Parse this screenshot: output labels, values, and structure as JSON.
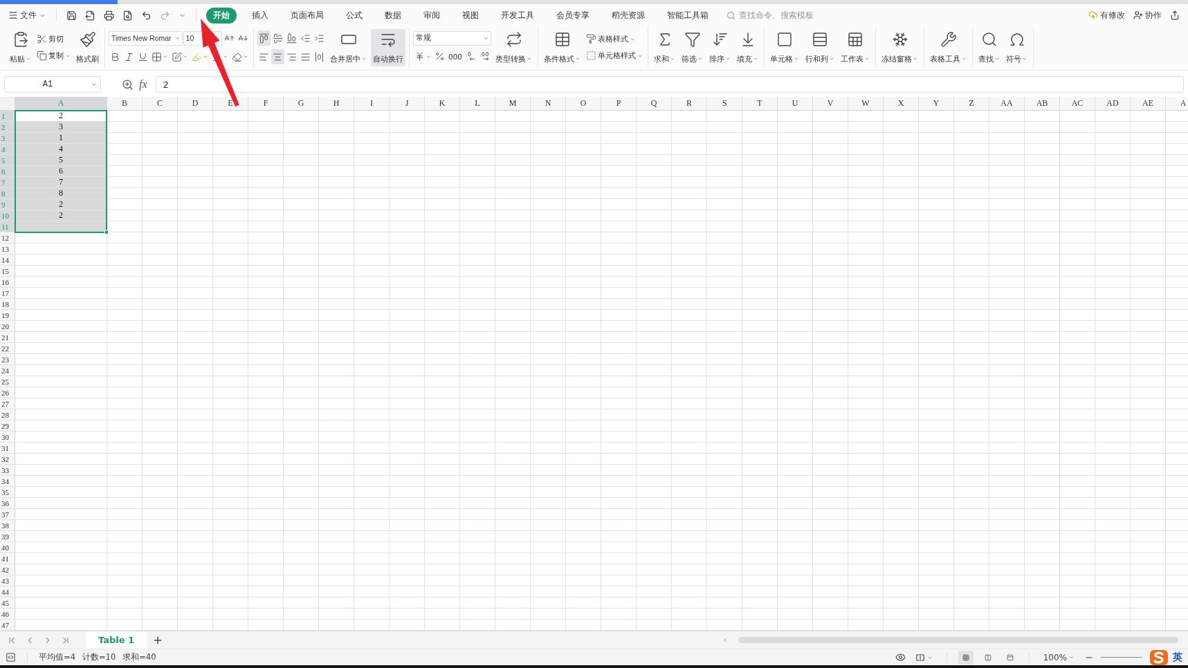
{
  "menu": {
    "file": "文件",
    "tabs": [
      {
        "label": "开始",
        "selected": true
      },
      {
        "label": "插入",
        "selected": false
      },
      {
        "label": "页面布局",
        "selected": false
      },
      {
        "label": "公式",
        "selected": false
      },
      {
        "label": "数据",
        "selected": false
      },
      {
        "label": "审阅",
        "selected": false
      },
      {
        "label": "视图",
        "selected": false
      },
      {
        "label": "开发工具",
        "selected": false
      },
      {
        "label": "会员专享",
        "selected": false
      },
      {
        "label": "稻壳资源",
        "selected": false
      },
      {
        "label": "智能工具箱",
        "selected": false
      }
    ],
    "search": {
      "placeholder": "查找命令、搜索模板"
    },
    "status": "有修改",
    "collaborate": "协作"
  },
  "ribbon": [
    {
      "columns": [
        {
          "kind": "big",
          "label": "粘贴",
          "dropdown": true
        },
        {
          "kind": "stack",
          "rows": [
            [
              {
                "kind": "small",
                "label": "剪切",
                "dropdown": false
              }
            ],
            [
              {
                "kind": "small",
                "label": "复制",
                "dropdown": true
              }
            ]
          ]
        },
        {
          "kind": "big",
          "label": "格式刷",
          "dropdown": false
        }
      ]
    },
    {
      "columns": [
        {
          "kind": "stack",
          "rows": [
            [
              {
                "kind": "select",
                "value": "Times New Romar"
              },
              {
                "kind": "select",
                "value": "10"
              },
              {
                "kind": "icon",
                "dropdown": false
              },
              {
                "kind": "icon",
                "dropdown": false
              }
            ],
            [
              {
                "kind": "icon",
                "dropdown": false
              },
              {
                "kind": "icon",
                "dropdown": false
              },
              {
                "kind": "icon",
                "dropdown": false
              },
              {
                "kind": "icon",
                "dropdown": true
              },
              {
                "kind": "icon",
                "dropdown": true
              },
              {
                "kind": "icon",
                "dropdown": true
              },
              {
                "kind": "icon",
                "dropdown": true
              },
              {
                "kind": "icon",
                "dropdown": true
              }
            ]
          ]
        }
      ]
    },
    {
      "columns": [
        {
          "kind": "stack",
          "rows": [
            [
              {
                "kind": "icon",
                "dropdown": false,
                "on": true
              },
              {
                "kind": "icon",
                "dropdown": false,
                "on": false
              },
              {
                "kind": "icon",
                "dropdown": false,
                "on": false
              },
              {
                "kind": "icon",
                "dropdown": false,
                "on": false
              },
              {
                "kind": "icon",
                "dropdown": false,
                "on": false
              }
            ],
            [
              {
                "kind": "icon",
                "dropdown": false,
                "on": false
              },
              {
                "kind": "icon",
                "dropdown": false,
                "on": true
              },
              {
                "kind": "icon",
                "dropdown": false,
                "on": false
              },
              {
                "kind": "icon",
                "dropdown": false,
                "on": false
              },
              {
                "kind": "icon",
                "dropdown": false,
                "on": false
              }
            ]
          ]
        },
        {
          "kind": "big",
          "label": "合并居中",
          "dropdown": true,
          "on": false
        },
        {
          "kind": "big",
          "label": "自动换行",
          "dropdown": false,
          "on": true
        }
      ]
    },
    {
      "columns": [
        {
          "kind": "stack",
          "rows": [
            [
              {
                "kind": "select",
                "value": "常规"
              }
            ],
            [
              {
                "kind": "icon",
                "dropdown": true
              },
              {
                "kind": "icon",
                "dropdown": false
              },
              {
                "kind": "text",
                "label": "000"
              },
              {
                "kind": "icon",
                "dropdown": false
              },
              {
                "kind": "icon",
                "dropdown": false
              }
            ]
          ]
        },
        {
          "kind": "big",
          "label": "类型转换",
          "dropdown": true
        }
      ]
    },
    {
      "columns": [
        {
          "kind": "big",
          "label": "条件格式",
          "dropdown": true
        },
        {
          "kind": "stack",
          "rows": [
            [
              {
                "kind": "small",
                "label": "表格样式",
                "dropdown": true
              }
            ],
            [
              {
                "kind": "small",
                "label": "单元格样式",
                "dropdown": true
              }
            ]
          ]
        }
      ]
    },
    {
      "columns": [
        {
          "kind": "big",
          "label": "求和",
          "dropdown": true
        },
        {
          "kind": "big",
          "label": "筛选",
          "dropdown": true
        },
        {
          "kind": "big",
          "label": "排序",
          "dropdown": true
        },
        {
          "kind": "big",
          "label": "填充",
          "dropdown": true
        }
      ]
    },
    {
      "columns": [
        {
          "kind": "big",
          "label": "单元格",
          "dropdown": true
        },
        {
          "kind": "big",
          "label": "行和列",
          "dropdown": true
        },
        {
          "kind": "big",
          "label": "工作表",
          "dropdown": true
        }
      ]
    },
    {
      "columns": [
        {
          "kind": "big",
          "label": "冻结窗格",
          "dropdown": true
        }
      ]
    },
    {
      "columns": [
        {
          "kind": "big",
          "label": "表格工具",
          "dropdown": true
        }
      ]
    },
    {
      "columns": [
        {
          "kind": "big",
          "label": "查找",
          "dropdown": true
        },
        {
          "kind": "big",
          "label": "符号",
          "dropdown": true
        }
      ]
    }
  ],
  "formula_bar": {
    "cell": "A1",
    "fx": "fx",
    "formula": "2"
  },
  "columns": [
    {
      "label": "A",
      "selected": true
    },
    {
      "label": "B",
      "selected": false
    },
    {
      "label": "C",
      "selected": false
    },
    {
      "label": "D",
      "selected": false
    },
    {
      "label": "E",
      "selected": false
    },
    {
      "label": "F",
      "selected": false
    },
    {
      "label": "G",
      "selected": false
    },
    {
      "label": "H",
      "selected": false
    },
    {
      "label": "I",
      "selected": false
    },
    {
      "label": "J",
      "selected": false
    },
    {
      "label": "K",
      "selected": false
    },
    {
      "label": "L",
      "selected": false
    },
    {
      "label": "M",
      "selected": false
    },
    {
      "label": "N",
      "selected": false
    },
    {
      "label": "O",
      "selected": false
    },
    {
      "label": "P",
      "selected": false
    },
    {
      "label": "Q",
      "selected": false
    },
    {
      "label": "R",
      "selected": false
    },
    {
      "label": "S",
      "selected": false
    },
    {
      "label": "T",
      "selected": false
    },
    {
      "label": "U",
      "selected": false
    },
    {
      "label": "V",
      "selected": false
    },
    {
      "label": "W",
      "selected": false
    },
    {
      "label": "X",
      "selected": false
    },
    {
      "label": "Y",
      "selected": false
    },
    {
      "label": "Z",
      "selected": false
    },
    {
      "label": "AA",
      "selected": false
    },
    {
      "label": "AB",
      "selected": false
    },
    {
      "label": "AC",
      "selected": false
    },
    {
      "label": "AD",
      "selected": false
    },
    {
      "label": "AE",
      "selected": false
    },
    {
      "label": "A",
      "selected": false
    }
  ],
  "rows": [
    {
      "label": "1",
      "selected": true
    },
    {
      "label": "2",
      "selected": true
    },
    {
      "label": "3",
      "selected": true
    },
    {
      "label": "4",
      "selected": true
    },
    {
      "label": "5",
      "selected": true
    },
    {
      "label": "6",
      "selected": true
    },
    {
      "label": "7",
      "selected": true
    },
    {
      "label": "8",
      "selected": true
    },
    {
      "label": "9",
      "selected": true
    },
    {
      "label": "10",
      "selected": true
    },
    {
      "label": "11",
      "selected": true
    },
    {
      "label": "12",
      "selected": false
    },
    {
      "label": "13",
      "selected": false
    },
    {
      "label": "14",
      "selected": false
    },
    {
      "label": "15",
      "selected": false
    },
    {
      "label": "16",
      "selected": false
    },
    {
      "label": "17",
      "selected": false
    },
    {
      "label": "18",
      "selected": false
    },
    {
      "label": "19",
      "selected": false
    },
    {
      "label": "20",
      "selected": false
    },
    {
      "label": "21",
      "selected": false
    },
    {
      "label": "22",
      "selected": false
    },
    {
      "label": "23",
      "selected": false
    },
    {
      "label": "24",
      "selected": false
    },
    {
      "label": "25",
      "selected": false
    },
    {
      "label": "26",
      "selected": false
    },
    {
      "label": "27",
      "selected": false
    },
    {
      "label": "28",
      "selected": false
    },
    {
      "label": "29",
      "selected": false
    },
    {
      "label": "30",
      "selected": false
    },
    {
      "label": "31",
      "selected": false
    },
    {
      "label": "32",
      "selected": false
    },
    {
      "label": "33",
      "selected": false
    },
    {
      "label": "34",
      "selected": false
    },
    {
      "label": "35",
      "selected": false
    },
    {
      "label": "36",
      "selected": false
    },
    {
      "label": "37",
      "selected": false
    },
    {
      "label": "38",
      "selected": false
    },
    {
      "label": "39",
      "selected": false
    },
    {
      "label": "40",
      "selected": false
    },
    {
      "label": "41",
      "selected": false
    },
    {
      "label": "42",
      "selected": false
    },
    {
      "label": "43",
      "selected": false
    },
    {
      "label": "44",
      "selected": false
    },
    {
      "label": "45",
      "selected": false
    },
    {
      "label": "46",
      "selected": false
    },
    {
      "label": "47",
      "selected": false
    }
  ],
  "cells": [
    {
      "value": "2",
      "selected": true,
      "active": true
    },
    {
      "value": "3",
      "selected": true,
      "active": false
    },
    {
      "value": "1",
      "selected": true,
      "active": false
    },
    {
      "value": "4",
      "selected": true,
      "active": false
    },
    {
      "value": "5",
      "selected": true,
      "active": false
    },
    {
      "value": "6",
      "selected": true,
      "active": false
    },
    {
      "value": "7",
      "selected": true,
      "active": false
    },
    {
      "value": "8",
      "selected": true,
      "active": false
    },
    {
      "value": "2",
      "selected": true,
      "active": false
    },
    {
      "value": "2",
      "selected": true,
      "active": false
    },
    {
      "selected": true,
      "active": false
    }
  ],
  "sheet_tabs": [
    {
      "label": "Table 1",
      "selected": true
    }
  ],
  "status_bar": {
    "stats": [
      "平均值=4",
      "计数=10",
      "求和=40"
    ],
    "views": [
      {
        "selected": true
      },
      {
        "selected": false
      },
      {
        "selected": false
      }
    ],
    "zoom": "100%",
    "ime": "英"
  }
}
